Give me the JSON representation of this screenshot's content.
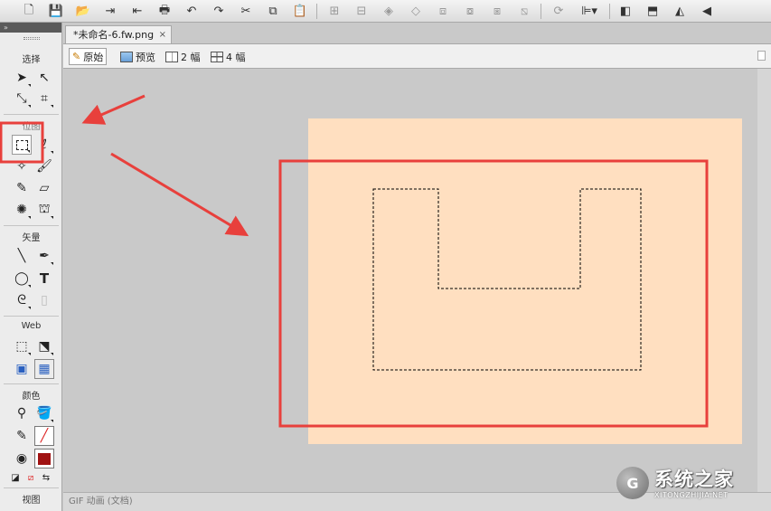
{
  "doc_tab": {
    "title": "*未命名-6.fw.png",
    "close": "×"
  },
  "view_bar": {
    "original": "原始",
    "preview": "预览",
    "two_up": "2 幅",
    "four_up": "4 幅"
  },
  "tools": {
    "collapse": "»",
    "sections": {
      "select": "选择",
      "bitmap": "位图",
      "vector": "矢量",
      "web": "Web",
      "colors": "颜色",
      "view": "视图"
    }
  },
  "status": {
    "text": "GIF 动画 (文档)"
  },
  "watermark": {
    "logo": "G",
    "name": "系统之家",
    "url": "XITONGZHIJIA.NET"
  },
  "colors": {
    "canvas": "#ffdfc0",
    "highlight": "#e8403c",
    "fill_swatch": "#a01212",
    "marquee": "#000000"
  },
  "icons": {
    "toolbar": [
      "new-file-icon",
      "save-icon",
      "open-icon",
      "import-icon",
      "export-icon",
      "print-icon",
      "undo-icon",
      "redo-icon",
      "cut-icon",
      "copy-icon",
      "paste-icon",
      "group-icon",
      "ungroup-icon",
      "join-icon",
      "split-icon",
      "front-icon",
      "forward-icon",
      "backward-icon",
      "back-icon",
      "rotate-icon",
      "align-icon",
      "flip-left-icon",
      "flip-vertical-icon",
      "flip-horizontal-icon",
      "skew-icon"
    ]
  }
}
